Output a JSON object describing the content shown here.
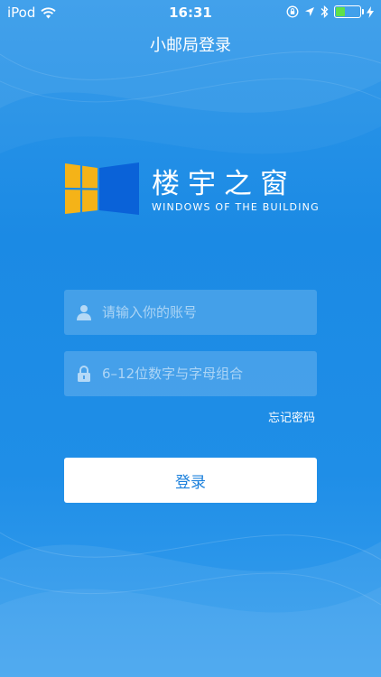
{
  "status_bar": {
    "carrier": "iPod",
    "time": "16:31",
    "icons": [
      "wifi-icon",
      "orientation-lock-icon",
      "location-icon",
      "bluetooth-icon",
      "battery-icon",
      "charging-icon"
    ],
    "battery_level": 0.4
  },
  "nav": {
    "title": "小邮局登录"
  },
  "logo": {
    "title": "楼宇之窗",
    "subtitle": "WINDOWS OF THE BUILDING",
    "icon": "windows-logo-icon"
  },
  "login_form": {
    "username_placeholder": "请输入你的账号",
    "username_icon": "user-icon",
    "password_placeholder": "6–12位数字与字母组合",
    "password_icon": "lock-icon",
    "forgot_label": "忘记密码",
    "submit_label": "登录"
  },
  "colors": {
    "background": "#1b8ae4",
    "button_text": "#1b80dc",
    "logo_yellow": "#f5b318",
    "logo_blue": "#0a62d8",
    "battery_green": "#5fe04a"
  }
}
